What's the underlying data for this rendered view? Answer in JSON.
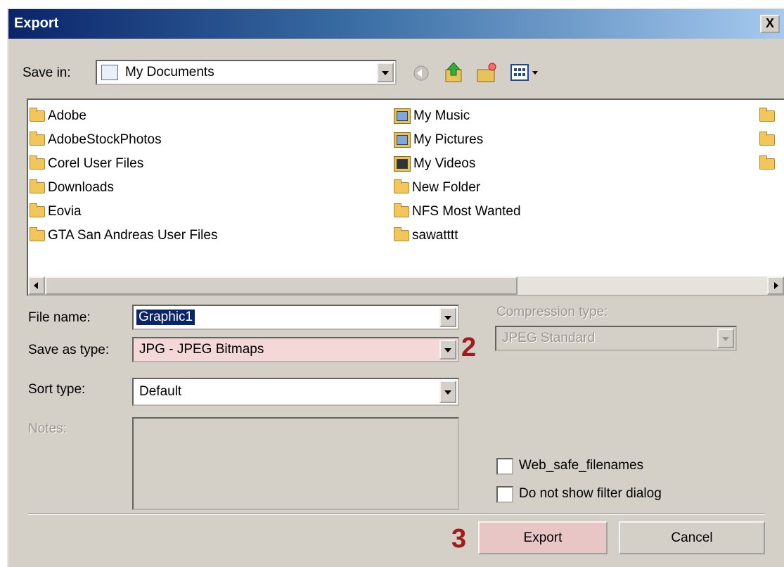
{
  "window": {
    "title": "Export"
  },
  "save_in": {
    "label": "Save in:",
    "value": "My Documents"
  },
  "toolbar": {
    "icons": [
      "back-icon",
      "up-folder-icon",
      "new-folder-icon",
      "view-menu-icon"
    ]
  },
  "files": {
    "column1": [
      "Adobe",
      "AdobeStockPhotos",
      "Corel User Files",
      "Downloads",
      "Eovia",
      "GTA San Andreas User Files"
    ],
    "column2": [
      "My Music",
      "My Pictures",
      "My Videos",
      "New Folder",
      "NFS Most Wanted",
      "sawatttt"
    ]
  },
  "form": {
    "file_name_label": "File name:",
    "file_name_value": "Graphic1",
    "save_as_type_label": "Save as type:",
    "save_as_type_value": "JPG - JPEG Bitmaps",
    "sort_type_label": "Sort type:",
    "sort_type_value": "Default",
    "notes_label": "Notes:",
    "compression_label": "Compression type:",
    "compression_value": "JPEG Standard"
  },
  "checkboxes": {
    "web_safe": "Web_safe_filenames",
    "no_filter": "Do not show filter dialog"
  },
  "buttons": {
    "export": "Export",
    "cancel": "Cancel",
    "close": "X"
  },
  "markers": {
    "step2": "2",
    "step3": "3"
  },
  "colors": {
    "highlight": "#f4d7d7",
    "marker": "#a01c1c",
    "selection": "#0a246a"
  }
}
